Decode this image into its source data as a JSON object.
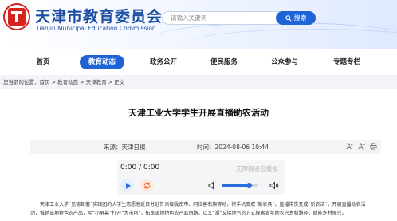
{
  "header": {
    "logo_text": "天津市教育委员会",
    "title": "天津市教育委员会",
    "subtitle": "Tianjin Municipal Education Commission",
    "search_placeholder": "请输入关键词",
    "search_button": "搜索"
  },
  "nav": {
    "items": [
      {
        "label": "首页",
        "active": false
      },
      {
        "label": "教育动态",
        "active": true
      },
      {
        "label": "政务公开",
        "active": false
      },
      {
        "label": "便民服务",
        "active": false
      },
      {
        "label": "公众参与",
        "active": false
      },
      {
        "label": "专题专栏",
        "active": false
      }
    ]
  },
  "breadcrumb": {
    "prefix": "您当前的位置：",
    "items": [
      "首页",
      "教育动态",
      "天津教育",
      "正文"
    ],
    "separator": " > "
  },
  "article": {
    "title": "天津工业大学学生开展直播助农活动",
    "source_label": "来源：",
    "source": "天津日报",
    "date_label": "时间：",
    "date": "2024-08-06 10:44",
    "body": "天津工业大学“见德知著”实践团的大学生志愿者近日分赴甘肃省陇南市、阿拉善右旗等地，将手机变成“新农具”，直播带货变成“新农活”，开展直播助农活动，推销当地特色农产品，用“小屏幕”打开“大市场”，拓宽当地特色农产品销路，以又“潮”又接地气的方式探索青年助农兴乡新路径，赋能乡村振兴。"
  },
  "player": {
    "time": "0:00 / 0:00",
    "voice_label": "无障碍语音播报",
    "volume": 0.75
  },
  "colors": {
    "brand_blue": "#1e64d6",
    "title_blue": "#1b4da3",
    "logo_red": "#d7231e"
  }
}
